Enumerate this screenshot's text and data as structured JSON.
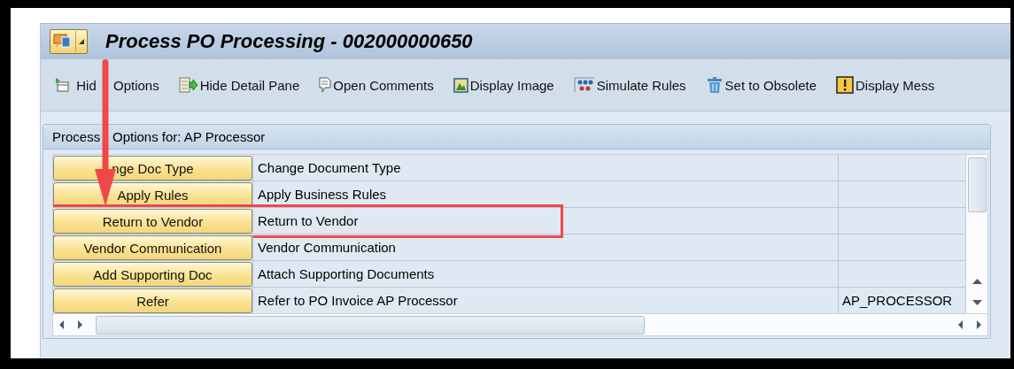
{
  "title_bar": {
    "title": "Process PO Processing - 002000000650"
  },
  "toolbar": [
    {
      "label_parts": [
        "Hid",
        "Options"
      ],
      "kind": "options"
    },
    {
      "label": "Hide Detail Pane",
      "kind": "pane"
    },
    {
      "label": "Open Comments",
      "kind": "comments"
    },
    {
      "label": "Display Image",
      "kind": "image"
    },
    {
      "label": "Simulate Rules",
      "kind": "rules"
    },
    {
      "label": "Set to Obsolete",
      "kind": "trash"
    },
    {
      "label": "Display Mess",
      "kind": "warning"
    }
  ],
  "panel": {
    "title_parts": [
      "Process",
      "Options for: AP Processor"
    ],
    "rows": [
      {
        "action": "nge Doc Type",
        "description": "Change Document Type",
        "highlighted": false
      },
      {
        "action": "Apply Rules",
        "description": "Apply Business Rules",
        "highlighted": false
      },
      {
        "action": "Return to Vendor",
        "description": "Return to Vendor",
        "highlighted": true
      },
      {
        "action": "Vendor Communication",
        "description": "Vendor Communication",
        "highlighted": false
      },
      {
        "action": "Add Supporting Doc",
        "description": "Attach Supporting Documents",
        "highlighted": false
      },
      {
        "action": "Refer",
        "description": "Refer to PO Invoice AP Processor",
        "column_3": "AP_PROCESSOR",
        "highlighted": false
      }
    ]
  }
}
